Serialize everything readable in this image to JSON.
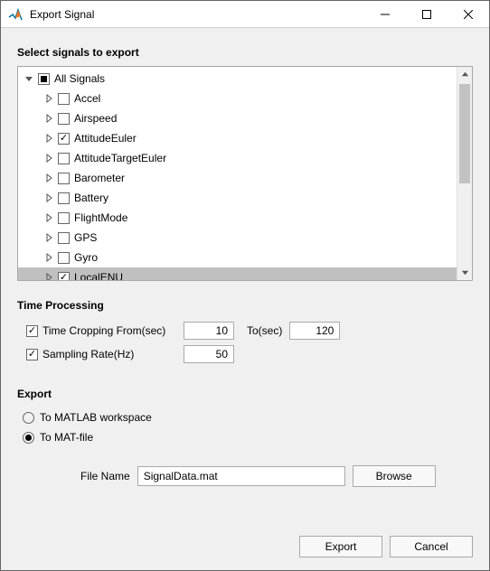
{
  "window": {
    "title": "Export Signal"
  },
  "headings": {
    "select_signals": "Select signals to export",
    "time_processing": "Time Processing",
    "export": "Export"
  },
  "tree": {
    "root": {
      "label": "All Signals",
      "state": "indeterminate",
      "expanded": true
    },
    "items": [
      {
        "label": "Accel",
        "checked": false,
        "selected": false
      },
      {
        "label": "Airspeed",
        "checked": false,
        "selected": false
      },
      {
        "label": "AttitudeEuler",
        "checked": true,
        "selected": false
      },
      {
        "label": "AttitudeTargetEuler",
        "checked": false,
        "selected": false
      },
      {
        "label": "Barometer",
        "checked": false,
        "selected": false
      },
      {
        "label": "Battery",
        "checked": false,
        "selected": false
      },
      {
        "label": "FlightMode",
        "checked": false,
        "selected": false
      },
      {
        "label": "GPS",
        "checked": false,
        "selected": false
      },
      {
        "label": "Gyro",
        "checked": false,
        "selected": false
      },
      {
        "label": "LocalENU",
        "checked": true,
        "selected": true
      }
    ]
  },
  "time": {
    "crop_enabled": true,
    "crop_label": "Time Cropping From(sec)",
    "crop_from": "10",
    "to_label": "To(sec)",
    "crop_to": "120",
    "rate_enabled": true,
    "rate_label": "Sampling Rate(Hz)",
    "rate_value": "50"
  },
  "export_opts": {
    "to_workspace": {
      "label": "To MATLAB workspace",
      "selected": false
    },
    "to_mat": {
      "label": "To MAT-file",
      "selected": true
    },
    "file_name_label": "File Name",
    "file_name": "SignalData.mat",
    "browse": "Browse"
  },
  "buttons": {
    "export": "Export",
    "cancel": "Cancel"
  }
}
